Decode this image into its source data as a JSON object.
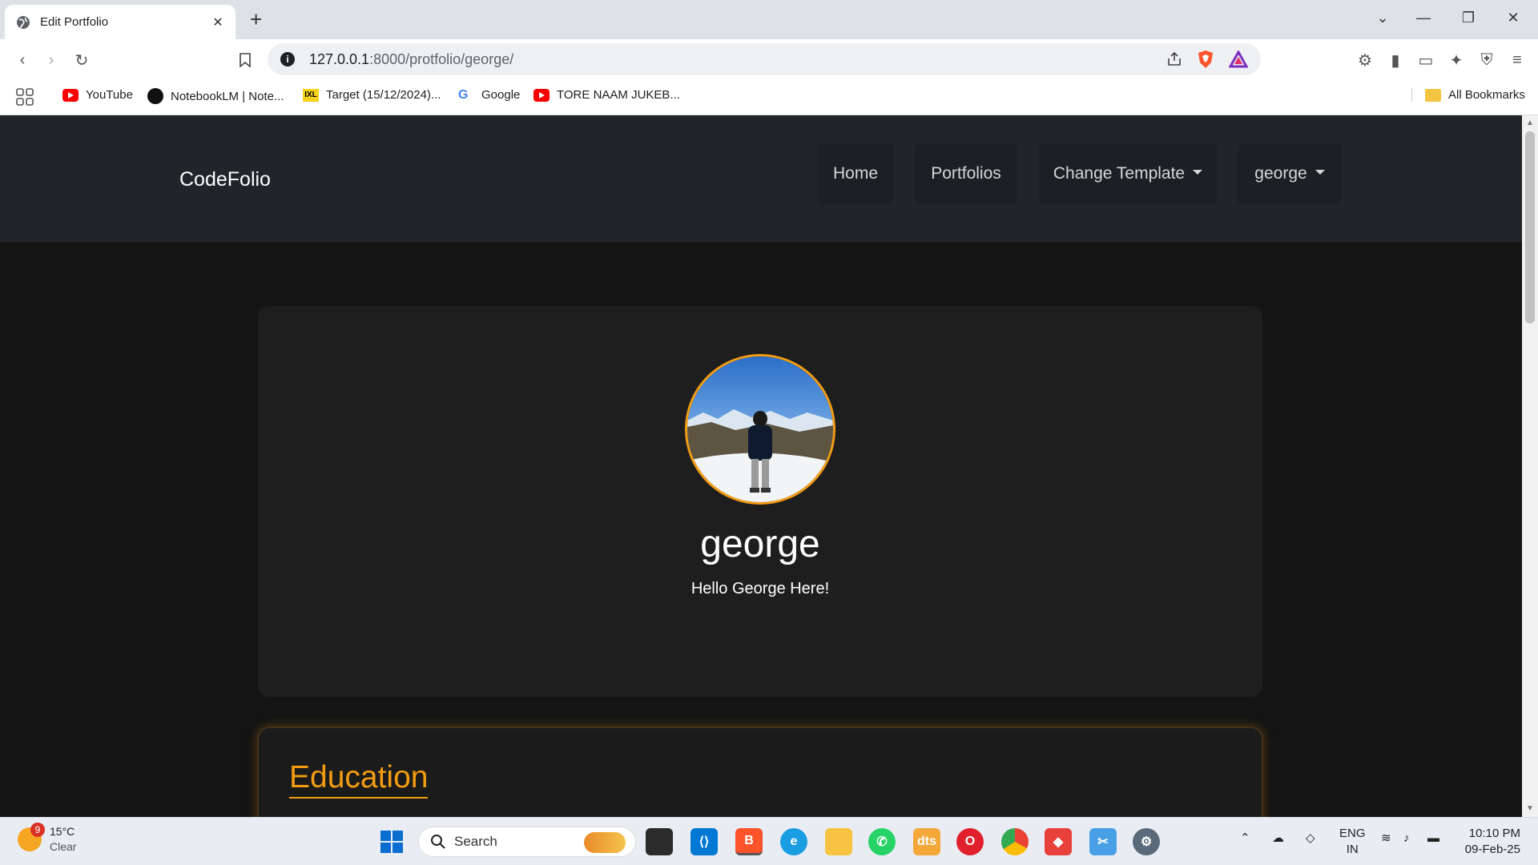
{
  "browser": {
    "tab_title": "Edit Portfolio",
    "url_host": "127.0.0.1",
    "url_rest": ":8000/protfolio/george/",
    "bookmarks": [
      {
        "label": "YouTube",
        "icon": "youtube-icon"
      },
      {
        "label": "NotebookLM | Note...",
        "icon": "notebooklm-icon"
      },
      {
        "label": "Target (15/12/2024)...",
        "icon": "ixl-icon"
      },
      {
        "label": "Google",
        "icon": "google-icon"
      },
      {
        "label": "TORE NAAM JUKEB...",
        "icon": "youtube-icon"
      }
    ],
    "all_bookmarks": "All Bookmarks"
  },
  "navbar": {
    "brand": "CodeFolio",
    "items": [
      "Home",
      "Portfolios",
      "Change Template",
      "george"
    ]
  },
  "profile": {
    "name": "george",
    "bio": "Hello George Here!"
  },
  "education": {
    "title": "Education"
  },
  "taskbar": {
    "temp": "15°C",
    "condition": "Clear",
    "weather_badge": "9",
    "search_placeholder": "Search",
    "lang_line1": "ENG",
    "lang_line2": "IN",
    "time": "10:10 PM",
    "date": "09-Feb-25"
  },
  "colors": {
    "accent": "#f39c12",
    "navbar": "#212529",
    "page_bg": "#141414",
    "card_bg": "#1e1e1e"
  }
}
